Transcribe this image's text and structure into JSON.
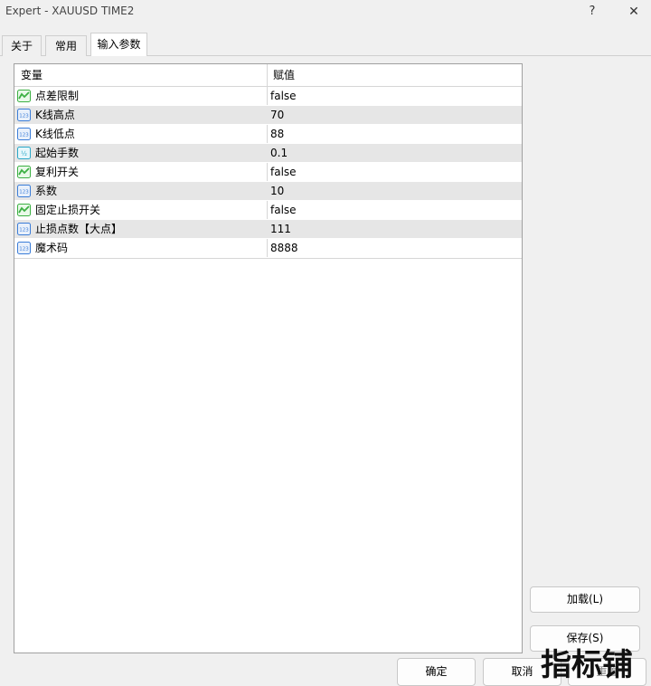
{
  "window": {
    "title": "Expert - XAUUSD TIME2"
  },
  "titlebar": {
    "help_glyph": "?",
    "close_glyph": "✕"
  },
  "tabs": [
    {
      "label": "关于"
    },
    {
      "label": "常用"
    },
    {
      "label": "输入参数",
      "active": true
    }
  ],
  "table": {
    "headers": {
      "variable": "变量",
      "value": "赋值"
    },
    "rows": [
      {
        "type": "bool",
        "icon": "toggle-icon",
        "name": "点差限制",
        "value": "false"
      },
      {
        "type": "int",
        "icon": "integer-icon",
        "name": "K线高点",
        "value": "70"
      },
      {
        "type": "int",
        "icon": "integer-icon",
        "name": "K线低点",
        "value": "88"
      },
      {
        "type": "double",
        "icon": "fraction-icon",
        "name": "起始手数",
        "value": "0.1"
      },
      {
        "type": "bool",
        "icon": "toggle-icon",
        "name": "复利开关",
        "value": "false"
      },
      {
        "type": "int",
        "icon": "integer-icon",
        "name": "系数",
        "value": "10"
      },
      {
        "type": "bool",
        "icon": "toggle-icon",
        "name": "固定止损开关",
        "value": "false"
      },
      {
        "type": "int",
        "icon": "integer-icon",
        "name": "止损点数【大点】",
        "value": "111"
      },
      {
        "type": "int",
        "icon": "integer-icon",
        "name": "魔术码",
        "value": "8888"
      }
    ]
  },
  "buttons": {
    "load": "加载(L)",
    "save": "保存(S)",
    "ok": "确定",
    "cancel": "取消",
    "reset": "重置"
  },
  "watermark": {
    "text": "指标铺"
  },
  "colors": {
    "row_alt": "#e6e6e6",
    "bool_icon": "#3cb043",
    "int_icon": "#3b7dd8",
    "double_icon": "#2aa8c8"
  }
}
